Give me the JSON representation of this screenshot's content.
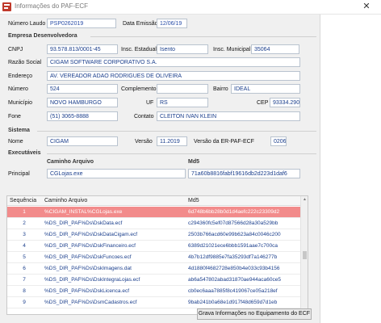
{
  "window": {
    "title": "Informações do PAF-ECF",
    "close_glyph": "✕"
  },
  "top": {
    "numero_laudo_label": "Número Laudo",
    "numero_laudo_value": "PSP0262019",
    "data_emissao_label": "Data Emissão",
    "data_emissao_value": "12/06/19"
  },
  "empresa": {
    "group_title": "Empresa Desenvolvedora",
    "cnpj_label": "CNPJ",
    "cnpj_value": "93.578.813/0001-45",
    "insc_estadual_label": "Insc. Estadual",
    "insc_estadual_value": "Isento",
    "insc_municipal_label": "Insc. Municipal",
    "insc_municipal_value": "35064",
    "razao_social_label": "Razão Social",
    "razao_social_value": "CIGAM SOFTWARE CORPORATIVO S.A.",
    "endereco_label": "Endereço",
    "endereco_value": "AV. VEREADOR ADAO RODRIGUES DE OLIVEIRA",
    "numero_label": "Número",
    "numero_value": "524",
    "complemento_label": "Complemento",
    "complemento_value": "",
    "bairro_label": "Bairro",
    "bairro_value": "IDEAL",
    "municipio_label": "Município",
    "municipio_value": "NOVO HAMBURGO",
    "uf_label": "UF",
    "uf_value": "RS",
    "cep_label": "CEP",
    "cep_value": "93334.290",
    "fone_label": "Fone",
    "fone_value": "(51) 3065-8888",
    "contato_label": "Contato",
    "contato_value": "CLEITON IVAN KLEIN"
  },
  "sistema": {
    "group_title": "Sistema",
    "nome_label": "Nome",
    "nome_value": "CIGAM",
    "versao_label": "Versão",
    "versao_value": "11.2019",
    "versao_er_label": "Versão da ER-PAF-ECF",
    "versao_er_value": "0206"
  },
  "executaveis": {
    "group_title": "Executáveis",
    "caminho_header": "Caminho Arquivo",
    "md5_header": "Md5",
    "principal_label": "Principal",
    "principal_path": "CGLojas.exe",
    "principal_md5": "71a60b8816fabf19616db2d223d1daf6"
  },
  "grid": {
    "headers": {
      "sequencia": "Sequência",
      "caminho": "Caminho Arquivo",
      "md5": "Md5"
    },
    "rows": [
      {
        "seq": "1",
        "path": "%CIGAM_INSTAL%CGLojas.exe",
        "md5": "6d748b6bb28b0d1d4aefc222c23309d2"
      },
      {
        "seq": "2",
        "path": "%DS_DIR_PAF%Ds\\DskData.ecf",
        "md5": "c294360fc5ef07d87566d28a30a529bb"
      },
      {
        "seq": "3",
        "path": "%DS_DIR_PAF%Ds\\DskDataCigam.ecf",
        "md5": "2503b766acd60e99b623a84c0046c200"
      },
      {
        "seq": "4",
        "path": "%DS_DIR_PAF%Ds\\DskFinanceiro.ecf",
        "md5": "6389d21021ece6bbb1591aae7c700ca"
      },
      {
        "seq": "5",
        "path": "%DS_DIR_PAF%Ds\\DskFuncoes.ecf",
        "md5": "4b7b12df9885e7fa35293df7a146277b"
      },
      {
        "seq": "6",
        "path": "%DS_DIR_PAF%Ds\\DskImagens.dat",
        "md5": "4d1880f4682728e850b4e033c93b4156"
      },
      {
        "seq": "7",
        "path": "%DS_DIR_PAF%Ds\\DskIntegraLojas.ecf",
        "md5": "ab6a547802abad31870ae944aca60ce5"
      },
      {
        "seq": "8",
        "path": "%DS_DIR_PAF%Ds\\DskLicenca.ecf",
        "md5": "cb0ec6aaa7885f8c419067ce05a218ef"
      },
      {
        "seq": "9",
        "path": "%DS_DIR_PAF%Ds\\DsmCadastros.ecf",
        "md5": "9bab241b0a68e1d917f48d659d7d1eb"
      }
    ],
    "selected_color": "#f28b8b"
  },
  "footer": {
    "button_label": "Grava Informações no Equipamento do ECF"
  }
}
